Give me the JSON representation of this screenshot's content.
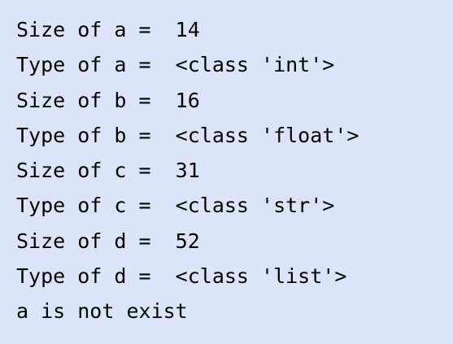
{
  "output": {
    "lines": [
      "Size of a =  14",
      "Type of a =  <class 'int'>",
      "Size of b =  16",
      "Type of b =  <class 'float'>",
      "Size of c =  31",
      "Type of c =  <class 'str'>",
      "Size of d =  52",
      "Type of d =  <class 'list'>",
      "a is not exist"
    ]
  },
  "colors": {
    "background": "#dbe4f8",
    "text": "#000000"
  }
}
